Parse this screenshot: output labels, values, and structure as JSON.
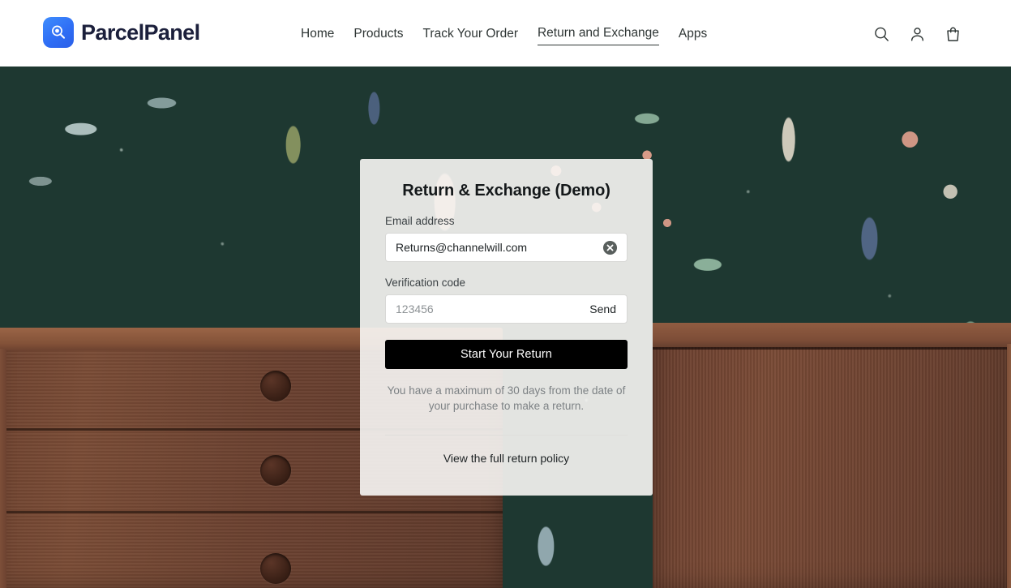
{
  "header": {
    "brand": {
      "name": "ParcelPanel",
      "logo_icon": "magnifier-parcel-logo-icon",
      "logo_color": "#2f6ef5"
    },
    "nav": [
      {
        "label": "Home",
        "active": false
      },
      {
        "label": "Products",
        "active": false
      },
      {
        "label": "Track Your Order",
        "active": false
      },
      {
        "label": "Return and Exchange",
        "active": true
      },
      {
        "label": "Apps",
        "active": false
      }
    ],
    "actions": [
      {
        "icon": "search-icon",
        "label": "Search"
      },
      {
        "icon": "account-person-icon",
        "label": "Account"
      },
      {
        "icon": "shopping-bag-icon",
        "label": "Cart"
      }
    ]
  },
  "scene": {
    "description": "Dark green botanical wallpaper with walnut dresser and cabinet",
    "wallpaper_color": "#1e3831",
    "wood_color": "#6b4130"
  },
  "card": {
    "title": "Return & Exchange (Demo)",
    "email": {
      "label": "Email address",
      "value": "Returns@channelwill.com",
      "placeholder": "Email address",
      "clear_icon": "clear-circle-icon"
    },
    "verification": {
      "label": "Verification code",
      "value": "",
      "placeholder": "123456",
      "send_label": "Send"
    },
    "submit_label": "Start Your Return",
    "help_note": "You have a maximum of 30 days from the date of your purchase to make a return.",
    "policy_link": "View the full return policy"
  }
}
